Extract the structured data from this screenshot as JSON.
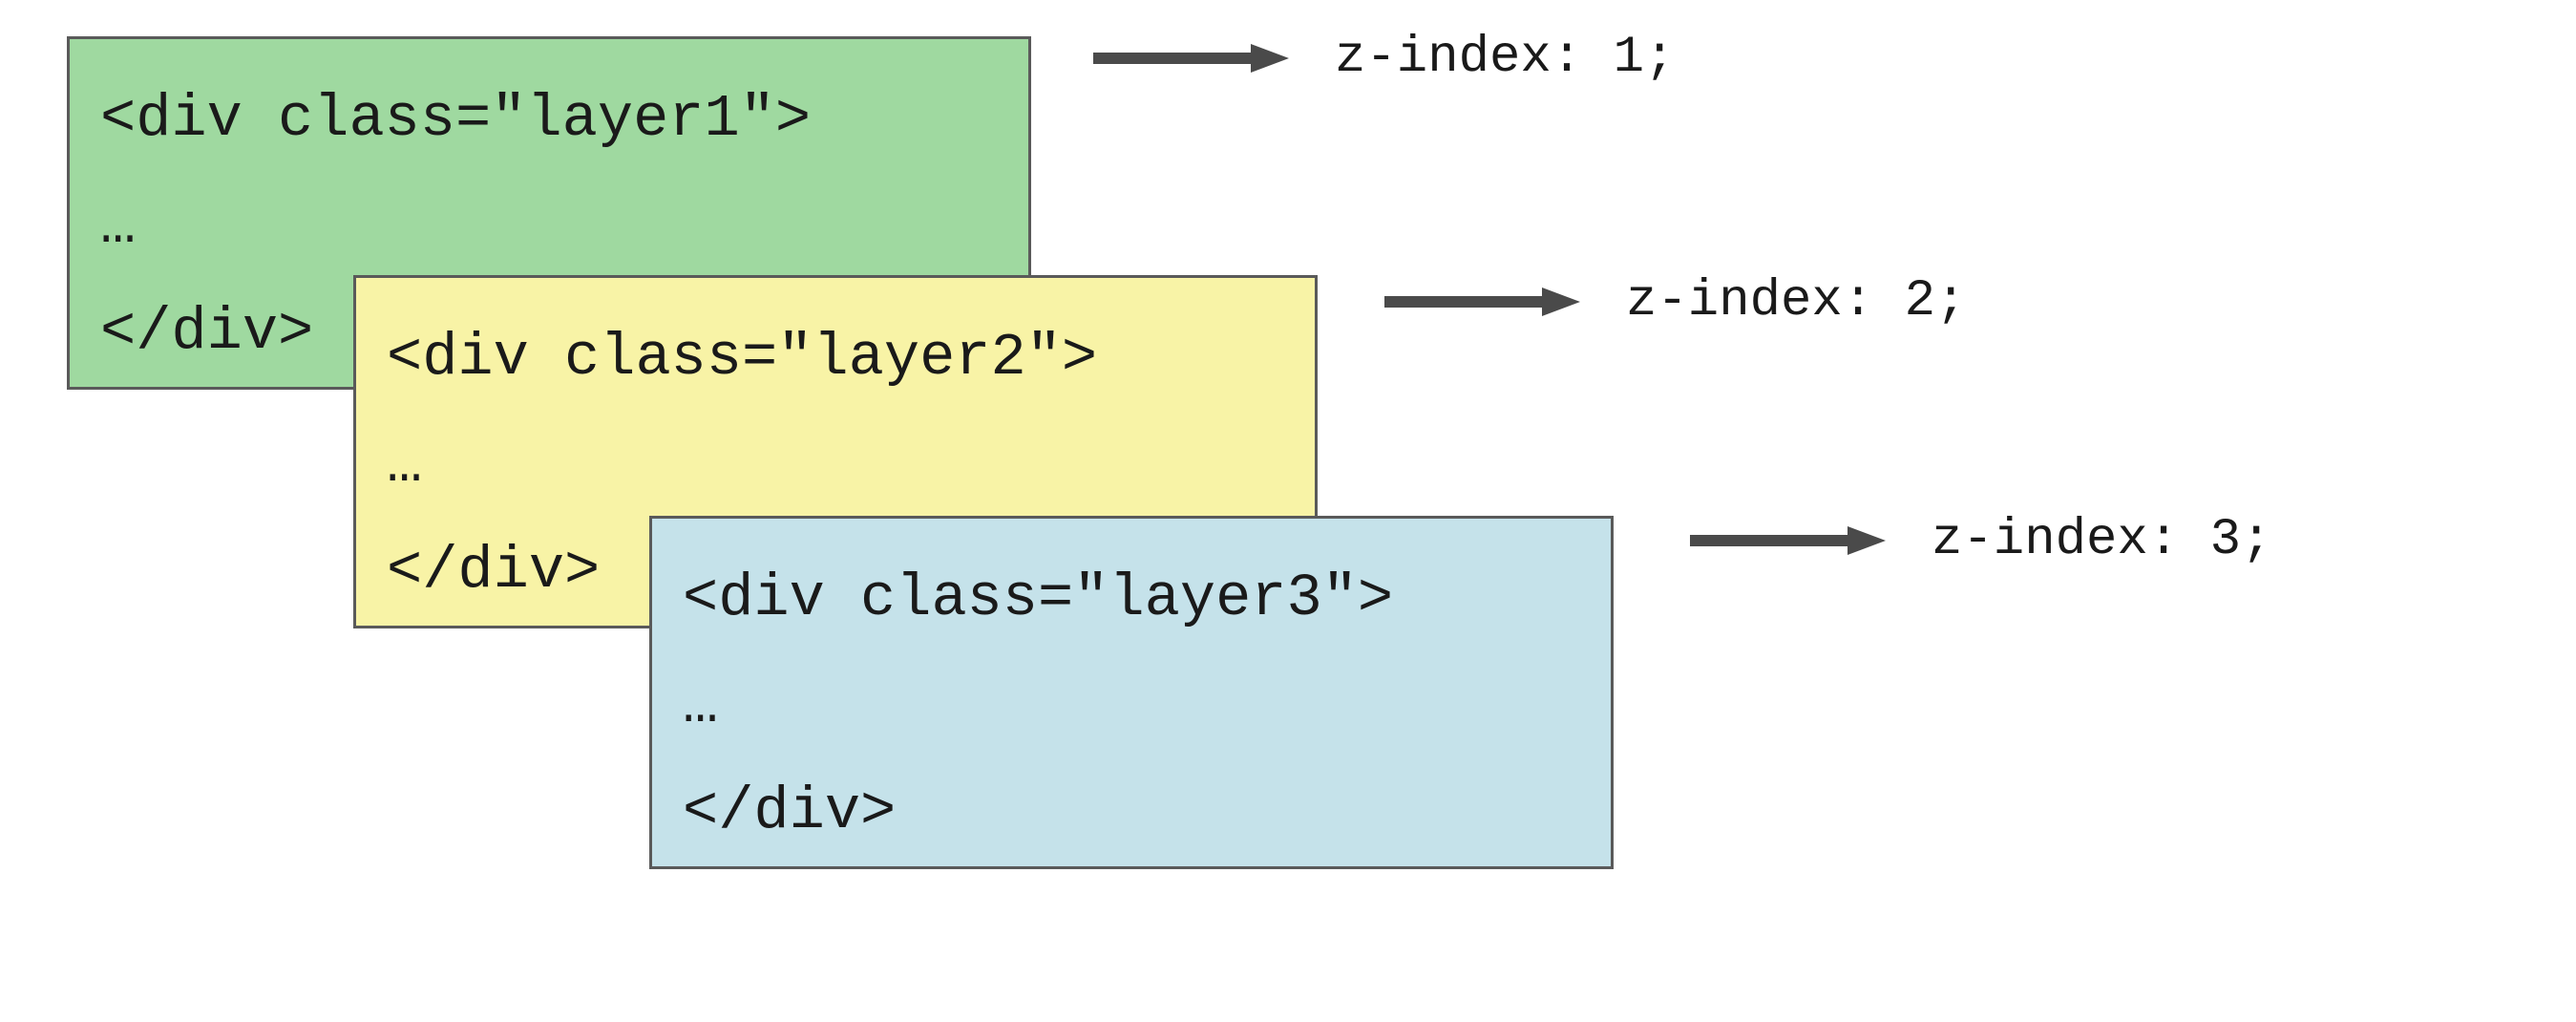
{
  "layers": [
    {
      "open": "<div class=\"layer1\">",
      "mid": "…",
      "close": "</div>",
      "annotation": "z-index: 1;",
      "color": "#9fd9a0"
    },
    {
      "open": "<div class=\"layer2\">",
      "mid": "…",
      "close": "</div>",
      "annotation": "z-index: 2;",
      "color": "#f8f3a6"
    },
    {
      "open": "<div class=\"layer3\">",
      "mid": "…",
      "close": "</div>",
      "annotation": "z-index: 3;",
      "color": "#c5e2ea"
    }
  ],
  "arrow_color": "#4a4a4a"
}
